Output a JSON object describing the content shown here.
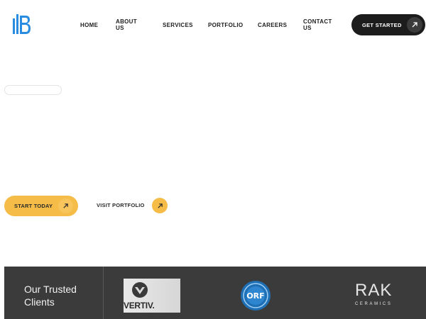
{
  "brand": {
    "logo_icon": "building-b-logo",
    "accent_color": "#f5bc48",
    "logo_color": "#2a8ce0"
  },
  "nav": {
    "items": [
      "HOME",
      "ABOUT US",
      "SERVICES",
      "PORTFOLIO",
      "CAREERS",
      "CONTACT US"
    ]
  },
  "header_cta": {
    "label": "GET STARTED",
    "icon": "arrow-up-right-icon"
  },
  "hero": {
    "start_label": "START TODAY",
    "visit_label": "VISIT PORTFOLIO",
    "arrow_icon": "arrow-up-right-icon"
  },
  "clients": {
    "title_line1": "Our Trusted",
    "title_line2": "Clients",
    "logos": [
      {
        "name": "VERTIV",
        "wordmark": "VERTIV."
      },
      {
        "name": "ORF",
        "wordmark": "ORF"
      },
      {
        "name": "RAK CERAMICS",
        "wordmark": "RAK",
        "sub": "CERAMICS"
      }
    ]
  }
}
